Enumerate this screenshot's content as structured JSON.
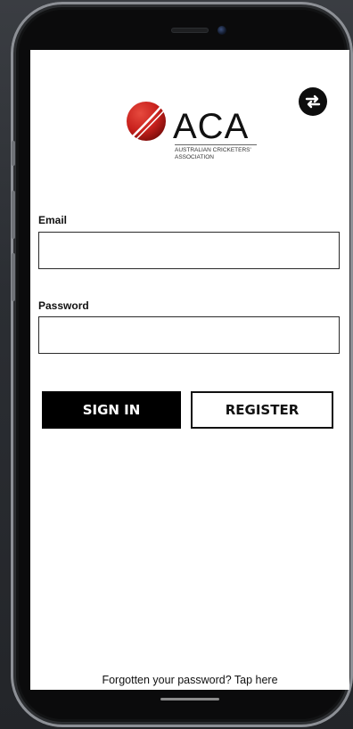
{
  "logo": {
    "title": "ACA",
    "subtitle": "AUSTRALIAN CRICKETERS'\nASSOCIATION"
  },
  "header": {
    "toggle_icon": "swap-arrows-icon"
  },
  "form": {
    "email_label": "Email",
    "email_value": "",
    "password_label": "Password",
    "password_value": ""
  },
  "buttons": {
    "sign_in": "SIGN IN",
    "register": "REGISTER"
  },
  "footer": {
    "forgot_text": "Forgotten your password? Tap here"
  },
  "colors": {
    "brand_red": "#c8201c",
    "primary": "#000000",
    "background": "#ffffff"
  }
}
